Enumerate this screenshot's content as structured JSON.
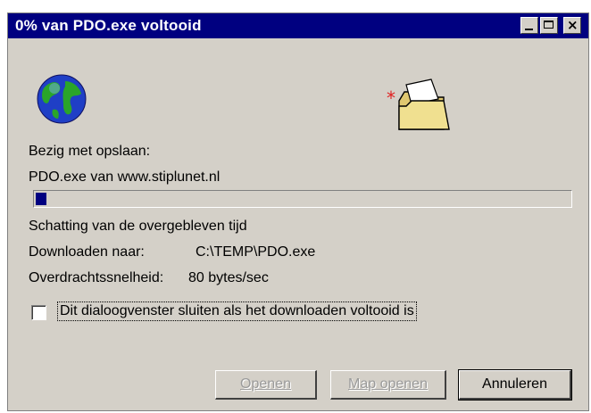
{
  "window": {
    "title": "0% van PDO.exe voltooid",
    "controls": {
      "minimize_icon": "minimize-icon",
      "maximize_icon": "maximize-icon",
      "close_icon": "close-icon",
      "close_glyph": "×"
    }
  },
  "icons": {
    "globe": "globe-icon",
    "folder": "open-folder-icon"
  },
  "status": {
    "saving_label": "Bezig met opslaan:",
    "file_source": "PDO.exe van www.stiplunet.nl",
    "progress_percent": 2,
    "estimated_time_label": "Schatting van de overgebleven tijd",
    "download_to_label": "Downloaden naar:",
    "download_to_value": "C:\\TEMP\\PDO.exe",
    "transfer_rate_label": "Overdrachtssnelheid:",
    "transfer_rate_value": "80 bytes/sec"
  },
  "option": {
    "close_when_done_label": "Dit dialoogvenster sluiten als het downloaden voltooid is",
    "checked": false
  },
  "buttons": {
    "open": "Openen",
    "open_folder": "Map openen",
    "cancel": "Annuleren"
  },
  "colors": {
    "titlebar": "#000080",
    "dialog": "#d4d0c8",
    "progress": "#000080"
  }
}
